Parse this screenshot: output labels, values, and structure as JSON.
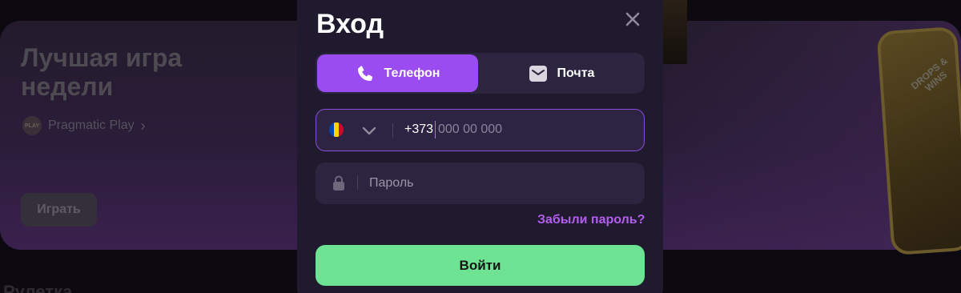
{
  "background": {
    "banner_title": "Лучшая игра недели",
    "provider_name": "Pragmatic Play",
    "provider_logo_text": "PLAY",
    "play_button": "Играть",
    "section_title": "Рулетка",
    "card_label": "DROPS & WINS"
  },
  "modal": {
    "title": "Вход",
    "tabs": [
      {
        "label": "Телефон",
        "icon": "phone-icon",
        "active": true
      },
      {
        "label": "Почта",
        "icon": "mail-icon",
        "active": false
      }
    ],
    "phone": {
      "country": "Moldova",
      "prefix": "+373",
      "placeholder": "000 00 000"
    },
    "password": {
      "placeholder": "Пароль"
    },
    "forgot_link": "Забыли пароль?",
    "submit_label": "Войти"
  },
  "colors": {
    "accent_purple": "#9a4cf0",
    "submit_green": "#6fe394",
    "modal_bg": "#1f1a2e"
  }
}
